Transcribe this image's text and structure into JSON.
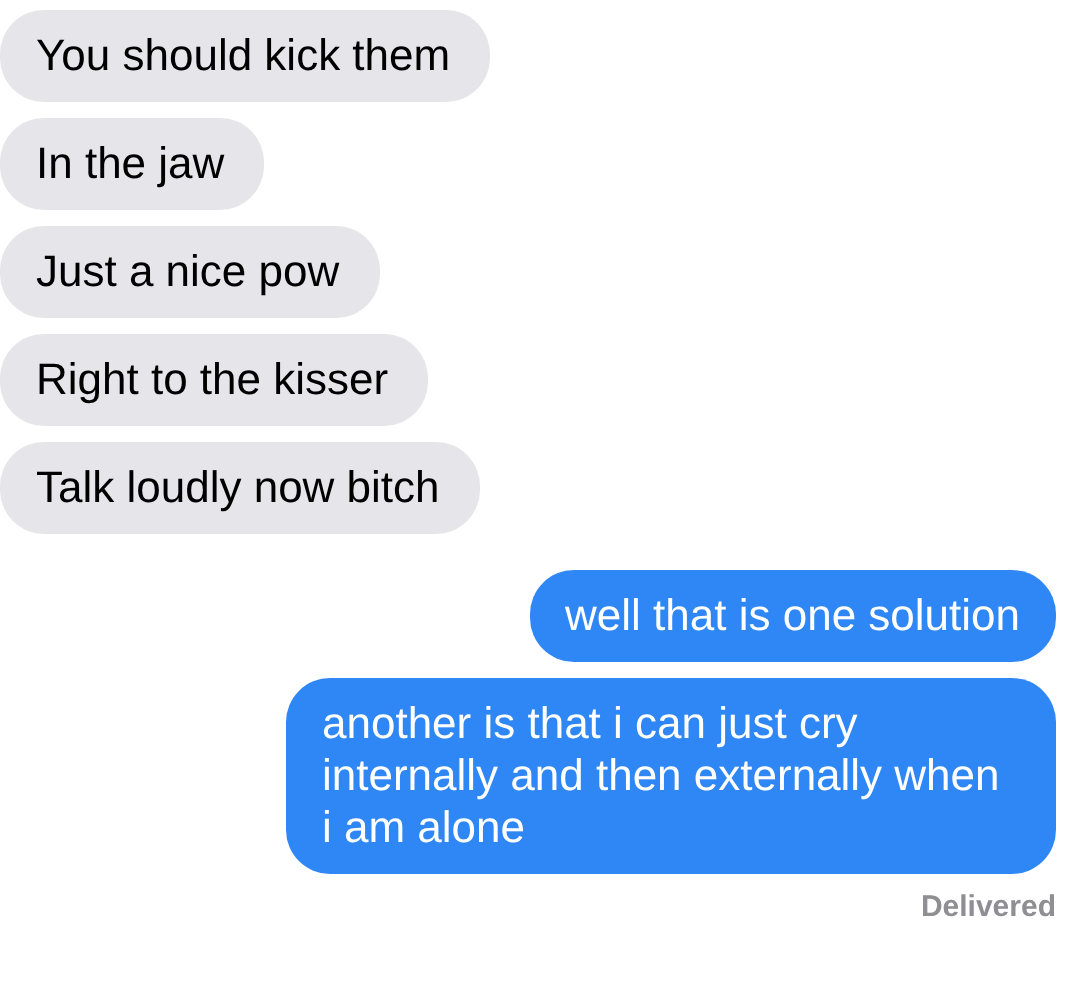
{
  "messages": [
    {
      "kind": "received",
      "text": "You should kick them"
    },
    {
      "kind": "received",
      "text": "In the jaw"
    },
    {
      "kind": "received",
      "text": "Just a nice pow"
    },
    {
      "kind": "received",
      "text": "Right to the kisser"
    },
    {
      "kind": "received",
      "text": "Talk loudly now bitch"
    },
    {
      "kind": "sent",
      "text": "well that is one solution"
    },
    {
      "kind": "sent",
      "text": "another is that i can just cry internally and then externally when i am alone"
    }
  ],
  "status": "Delivered"
}
